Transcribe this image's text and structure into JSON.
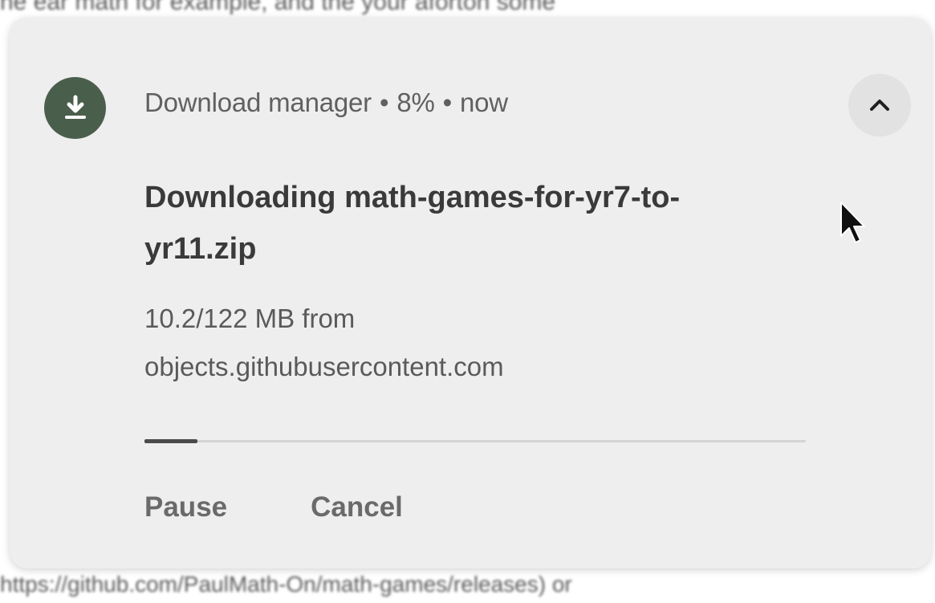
{
  "background": {
    "top_text": "ne ear math for example, and the your aforton some",
    "bottom_text": "https://github.com/PaulMath-On/math-games/releases) or"
  },
  "notification": {
    "app_name": "Download manager",
    "separator": "•",
    "progress_percent_text": "8%",
    "time": "now",
    "title": "Downloading math-games-for-yr7-to-yr11.zip",
    "subtitle_line1": "10.2/122 MB from",
    "subtitle_line2": "objects.githubusercontent.com",
    "progress_fraction": 0.08,
    "actions": {
      "pause_label": "Pause",
      "cancel_label": "Cancel"
    },
    "icons": {
      "app": "download-icon",
      "expand": "chevron-up-icon"
    },
    "colors": {
      "icon_background": "#4a5e4c",
      "progress_fill": "#4a4a4a",
      "progress_track": "#d4d4d4",
      "card_background": "#eeeeee"
    }
  }
}
